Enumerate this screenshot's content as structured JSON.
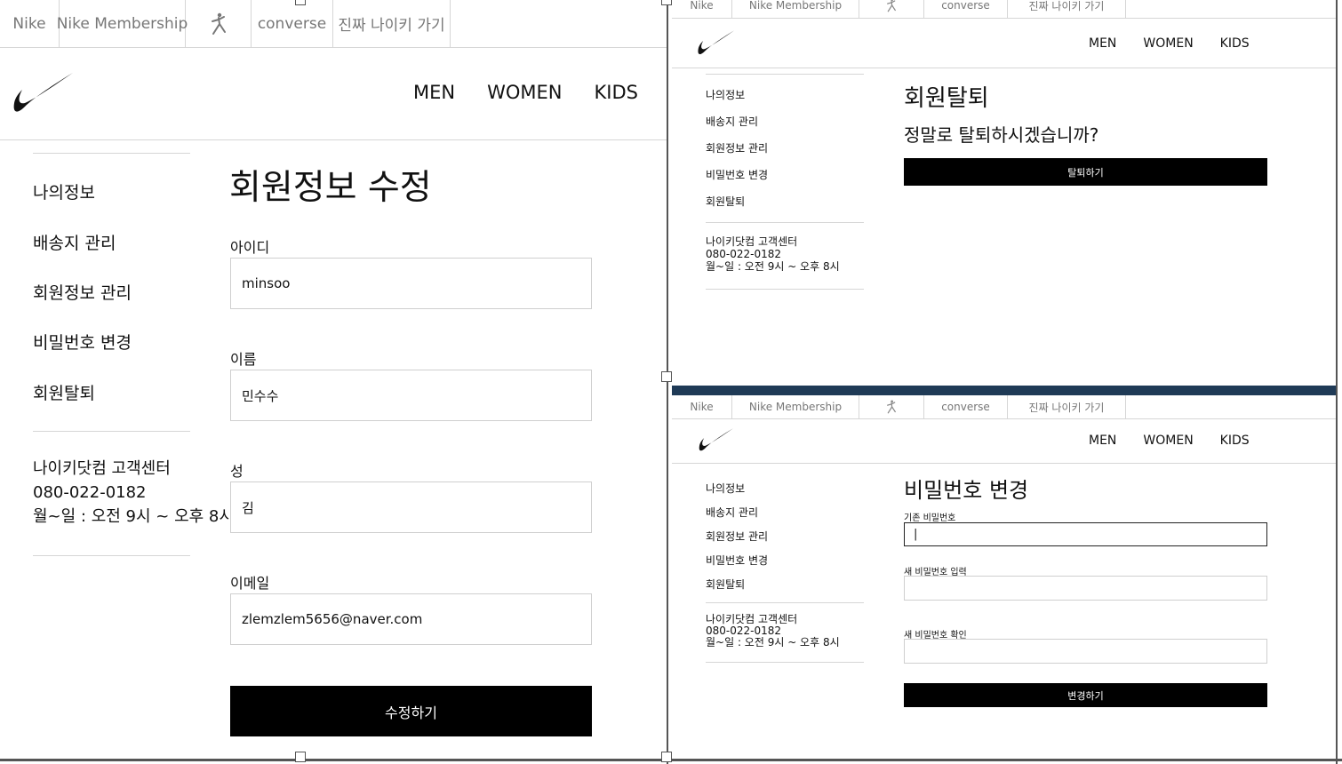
{
  "colors": {
    "button_bg": "#000000",
    "divider": "#d6d6d6",
    "editor_frame": "#555555",
    "strip_accent": "#1f3a56"
  },
  "common": {
    "topbar": [
      "Nike",
      "Nike Membership",
      "jordan-icon",
      "converse",
      "진짜 나이키 가기"
    ],
    "nav": [
      "MEN",
      "WOMEN",
      "KIDS"
    ],
    "sidebar": [
      "나의정보",
      "배송지 관리",
      "회원정보 관리",
      "비밀번호 변경",
      "회원탈퇴"
    ],
    "support": {
      "title": "나이키닷컴 고객센터",
      "phone": "080-022-0182",
      "hours": "월~일 : 오전 9시 ~ 오후 8시"
    },
    "logo_icon": "nike-swoosh-icon"
  },
  "edit_profile": {
    "title": "회원정보 수정",
    "fields": [
      {
        "label": "아이디",
        "value": "minsoo"
      },
      {
        "label": "이름",
        "value": "민수수"
      },
      {
        "label": "성",
        "value": "김"
      },
      {
        "label": "이메일",
        "value": "zlemzlem5656@naver.com"
      }
    ],
    "submit": "수정하기"
  },
  "withdraw": {
    "title": "회원탈퇴",
    "question": "정말로 탈퇴하시겠습니까?",
    "button": "탈퇴하기"
  },
  "change_password": {
    "title": "비밀번호 변경",
    "fields": [
      {
        "label": "기존 비밀번호",
        "value": "|"
      },
      {
        "label": "새 비밀번호 입력",
        "value": ""
      },
      {
        "label": "새 비밀번호 확인",
        "value": ""
      }
    ],
    "button": "변경하기"
  }
}
